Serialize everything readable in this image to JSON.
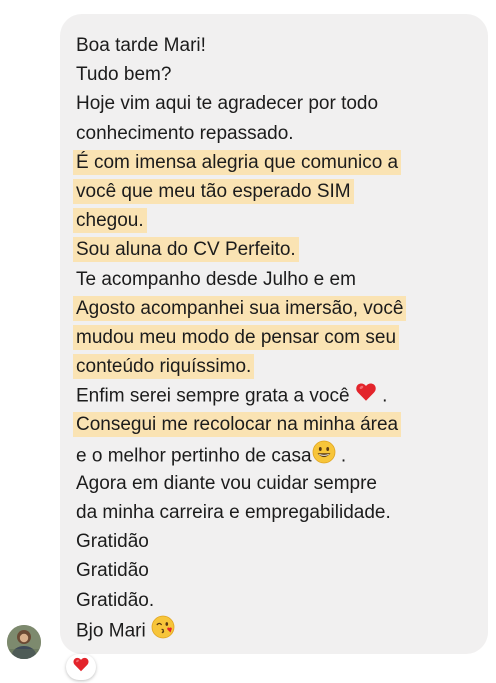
{
  "message": {
    "lines": [
      {
        "text": "Boa tarde Mari!"
      },
      {
        "text": "Tudo bem?"
      },
      {
        "text": "Hoje vim aqui te agradecer por todo"
      },
      {
        "text": "conhecimento repassado."
      },
      {
        "text": "É com imensa alegria que comunico a"
      },
      {
        "text": "você que meu tão esperado SIM"
      },
      {
        "text": "chegou."
      },
      {
        "text": "Sou aluna do CV Perfeito."
      },
      {
        "text": "Te acompanho desde Julho e em"
      },
      {
        "text": "Agosto acompanhei sua imersão, você"
      },
      {
        "text": "mudou meu modo de pensar com seu"
      },
      {
        "text": "conteúdo riquíssimo."
      },
      {
        "text": "Enfim serei sempre grata a você",
        "emoji": "red-heart-icon",
        "suffix": "."
      },
      {
        "text": "Consegui me recolocar na minha área"
      },
      {
        "text": "e o melhor pertinho de casa",
        "emoji": "smiley-icon",
        "suffix": "."
      },
      {
        "text": "Agora em diante vou cuidar sempre"
      },
      {
        "text": "da minha carreira e empregabilidade."
      },
      {
        "text": "Gratidão"
      },
      {
        "text": "Gratidão"
      },
      {
        "text": "Gratidão."
      },
      {
        "text": "Bjo Mari",
        "emoji": "kiss-wink-icon"
      }
    ]
  },
  "reaction": {
    "icon": "red-heart-icon"
  },
  "colors": {
    "bubble": "#f1f0f0",
    "highlight": "#fae3b3",
    "text": "#1c1c1c",
    "heart": "#e3242b",
    "emoji_face": "#f7c53a"
  }
}
